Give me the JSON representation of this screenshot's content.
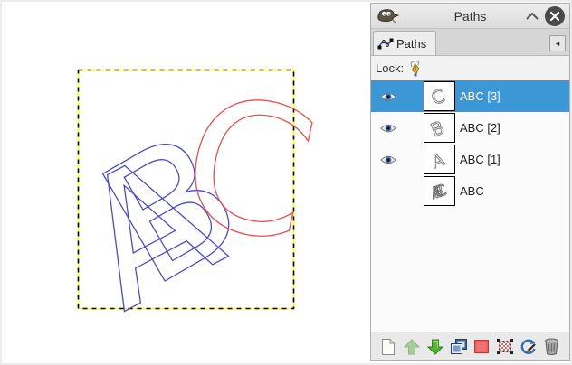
{
  "panel": {
    "title": "Paths",
    "tab": {
      "label": "Paths",
      "icon": "bezier-path-icon",
      "active": true
    },
    "tab_menu_glyph": "◂",
    "lock": {
      "label": "Lock:",
      "icon": "lock-path-strokes-pen-icon"
    }
  },
  "paths": {
    "rows": [
      {
        "label": "ABC [3]",
        "thumb": "C",
        "visible": true,
        "selected": true
      },
      {
        "label": "ABC [2]",
        "thumb": "B",
        "visible": true,
        "selected": false
      },
      {
        "label": "ABC [1]",
        "thumb": "A",
        "visible": true,
        "selected": false
      },
      {
        "label": "ABC",
        "thumb": "ABC",
        "visible": false,
        "selected": false
      }
    ]
  },
  "toolbar": {
    "buttons": [
      {
        "icon": "new-path-icon",
        "disabled": false
      },
      {
        "icon": "raise-path-icon",
        "disabled": true
      },
      {
        "icon": "lower-path-icon",
        "disabled": false
      },
      {
        "icon": "duplicate-path-icon",
        "disabled": false
      },
      {
        "icon": "path-to-selection-icon",
        "disabled": false
      },
      {
        "icon": "selection-to-path-icon",
        "disabled": false
      },
      {
        "icon": "stroke-path-icon",
        "disabled": false
      },
      {
        "icon": "delete-path-icon",
        "disabled": false
      }
    ]
  },
  "canvas": {
    "letters": [
      {
        "char": "A",
        "color": "#4a4ad0"
      },
      {
        "char": "B",
        "color": "#4a4ad0"
      },
      {
        "char": "C",
        "color": "#ee4b4b"
      }
    ],
    "layer_boundary": {
      "dash_colors": [
        "#ffff00",
        "#000000"
      ]
    }
  },
  "colors": {
    "selection_blue": "#3b97d6",
    "path_blue": "#4a4ad0",
    "path_red": "#ee4b4b"
  }
}
